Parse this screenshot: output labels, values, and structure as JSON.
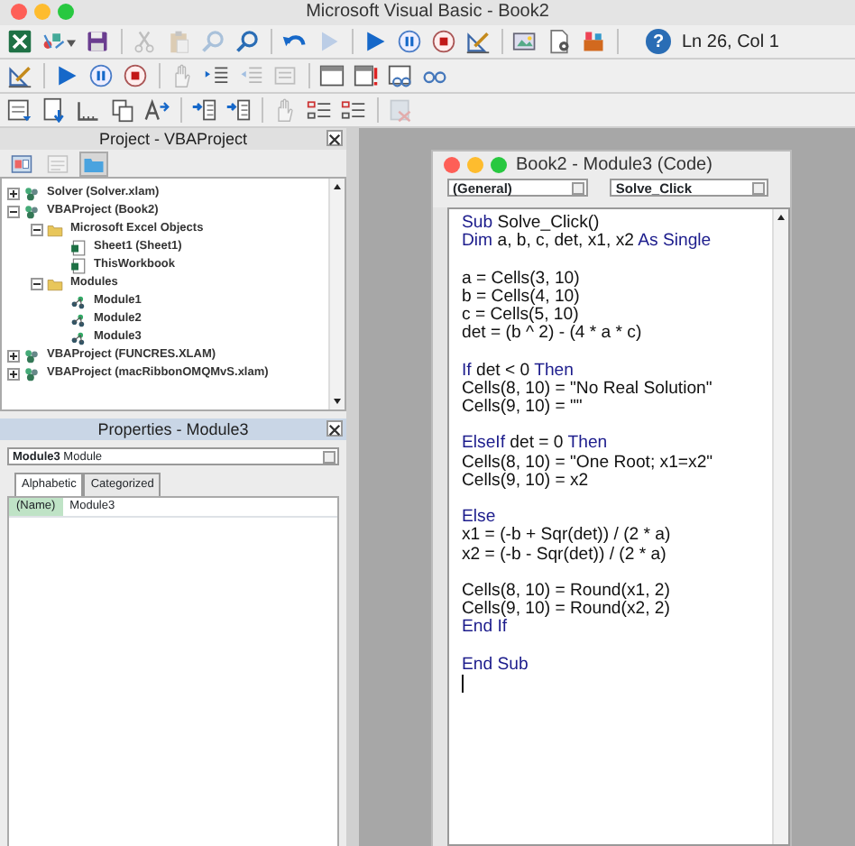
{
  "window": {
    "title": "Microsoft Visual Basic - Book2"
  },
  "toolbars": [
    {
      "items": [
        {
          "kind": "excel",
          "disabled": false
        },
        {
          "kind": "insert",
          "disabled": false
        },
        {
          "kind": "save",
          "disabled": false
        },
        {
          "kind": "separator"
        },
        {
          "kind": "cut",
          "disabled": true
        },
        {
          "kind": "paste",
          "disabled": true
        },
        {
          "kind": "find",
          "disabled": true
        },
        {
          "kind": "find",
          "disabled": false
        },
        {
          "kind": "separator"
        },
        {
          "kind": "undo",
          "disabled": false
        },
        {
          "kind": "redo",
          "disabled": true
        },
        {
          "kind": "separator"
        },
        {
          "kind": "run",
          "disabled": false
        },
        {
          "kind": "pause",
          "disabled": false
        },
        {
          "kind": "stop",
          "disabled": false
        },
        {
          "kind": "design",
          "disabled": false
        },
        {
          "kind": "separator"
        },
        {
          "kind": "explorer",
          "disabled": false
        },
        {
          "kind": "properties",
          "disabled": false
        },
        {
          "kind": "toolbox",
          "disabled": false
        },
        {
          "kind": "separator"
        },
        {
          "kind": "help",
          "disabled": false,
          "glyph": "?"
        }
      ],
      "status": "Ln 26, Col 1"
    },
    {
      "items": [
        {
          "kind": "design",
          "disabled": false
        },
        {
          "kind": "separator"
        },
        {
          "kind": "run",
          "disabled": false
        },
        {
          "kind": "pause",
          "disabled": false
        },
        {
          "kind": "stop",
          "disabled": false
        },
        {
          "kind": "separator"
        },
        {
          "kind": "hand",
          "disabled": true
        },
        {
          "kind": "indent",
          "disabled": false
        },
        {
          "kind": "outdent",
          "disabled": true
        },
        {
          "kind": "comment",
          "disabled": true
        },
        {
          "kind": "separator"
        },
        {
          "kind": "window",
          "disabled": false
        },
        {
          "kind": "window-alert",
          "disabled": false
        },
        {
          "kind": "watch",
          "disabled": false
        },
        {
          "kind": "glasses",
          "disabled": false
        }
      ]
    },
    {
      "items": [
        {
          "kind": "list-doc",
          "disabled": false
        },
        {
          "kind": "down-doc",
          "disabled": false
        },
        {
          "kind": "ruler",
          "disabled": false
        },
        {
          "kind": "copy",
          "disabled": false
        },
        {
          "kind": "replace",
          "disabled": false
        },
        {
          "kind": "separator"
        },
        {
          "kind": "bookmark",
          "disabled": false
        },
        {
          "kind": "bookmark",
          "disabled": false
        },
        {
          "kind": "separator"
        },
        {
          "kind": "hand",
          "disabled": true
        },
        {
          "kind": "list",
          "disabled": false
        },
        {
          "kind": "list",
          "disabled": false
        },
        {
          "kind": "separator"
        },
        {
          "kind": "clear",
          "disabled": true
        }
      ]
    }
  ],
  "project_panel": {
    "title": "Project - VBAProject",
    "view_buttons": [
      {
        "kind": "object",
        "selected": false,
        "disabled": false
      },
      {
        "kind": "code",
        "selected": false,
        "disabled": true
      },
      {
        "kind": "folders",
        "selected": true,
        "disabled": false
      }
    ],
    "tree": [
      {
        "label": "Solver (Solver.xlam)",
        "kind": "project",
        "expanded": false
      },
      {
        "label": "VBAProject (Book2)",
        "kind": "project",
        "expanded": true,
        "children": [
          {
            "label": "Microsoft Excel Objects",
            "kind": "folder",
            "expanded": true,
            "children": [
              {
                "label": "Sheet1 (Sheet1)",
                "kind": "sheet"
              },
              {
                "label": "ThisWorkbook",
                "kind": "sheet"
              }
            ]
          },
          {
            "label": "Modules",
            "kind": "folder",
            "expanded": true,
            "children": [
              {
                "label": "Module1",
                "kind": "module"
              },
              {
                "label": "Module2",
                "kind": "module"
              },
              {
                "label": "Module3",
                "kind": "module"
              }
            ]
          }
        ]
      },
      {
        "label": "VBAProject (FUNCRES.XLAM)",
        "kind": "project",
        "expanded": false
      },
      {
        "label": "VBAProject (macRibbonOMQMvS.xlam)",
        "kind": "project",
        "expanded": false
      }
    ]
  },
  "properties_panel": {
    "title": "Properties - Module3",
    "object": {
      "name": "Module3",
      "type": "Module"
    },
    "tabs": [
      {
        "label": "Alphabetic",
        "selected": true
      },
      {
        "label": "Categorized",
        "selected": false
      }
    ],
    "rows": [
      {
        "name": "(Name)",
        "value": "Module3",
        "selected": true
      }
    ]
  },
  "code_window": {
    "title": "Book2 - Module3 (Code)",
    "object_dropdown": "(General)",
    "procedure_dropdown": "Solve_Click",
    "lines": [
      {
        "kind": "code",
        "tokens": [
          {
            "kind": "keyword",
            "text": "Sub"
          },
          {
            "kind": "plain",
            "text": " Solve_Click()"
          }
        ]
      },
      {
        "kind": "code",
        "tokens": [
          {
            "kind": "keyword",
            "text": "Dim"
          },
          {
            "kind": "plain",
            "text": " a, b, c, det, x1, x2 "
          },
          {
            "kind": "keyword",
            "text": "As Single"
          }
        ]
      },
      {
        "kind": "blank"
      },
      {
        "kind": "code",
        "tokens": [
          {
            "kind": "plain",
            "text": "a = Cells(3, 10)"
          }
        ]
      },
      {
        "kind": "code",
        "tokens": [
          {
            "kind": "plain",
            "text": "b = Cells(4, 10)"
          }
        ]
      },
      {
        "kind": "code",
        "tokens": [
          {
            "kind": "plain",
            "text": "c = Cells(5, 10)"
          }
        ]
      },
      {
        "kind": "code",
        "tokens": [
          {
            "kind": "plain",
            "text": "det = (b ^ 2) - (4 * a * c)"
          }
        ]
      },
      {
        "kind": "blank"
      },
      {
        "kind": "code",
        "tokens": [
          {
            "kind": "keyword",
            "text": "If"
          },
          {
            "kind": "plain",
            "text": " det < 0 "
          },
          {
            "kind": "keyword",
            "text": "Then"
          }
        ]
      },
      {
        "kind": "code",
        "tokens": [
          {
            "kind": "plain",
            "text": "Cells(8, 10) = \"No Real Solution\""
          }
        ]
      },
      {
        "kind": "code",
        "tokens": [
          {
            "kind": "plain",
            "text": "Cells(9, 10) = \"\""
          }
        ]
      },
      {
        "kind": "blank"
      },
      {
        "kind": "code",
        "tokens": [
          {
            "kind": "keyword",
            "text": "ElseIf"
          },
          {
            "kind": "plain",
            "text": " det = 0 "
          },
          {
            "kind": "keyword",
            "text": "Then"
          }
        ]
      },
      {
        "kind": "code",
        "tokens": [
          {
            "kind": "plain",
            "text": "Cells(8, 10) = \"One Root; x1=x2\""
          }
        ]
      },
      {
        "kind": "code",
        "tokens": [
          {
            "kind": "plain",
            "text": "Cells(9, 10) = x2"
          }
        ]
      },
      {
        "kind": "blank"
      },
      {
        "kind": "code",
        "tokens": [
          {
            "kind": "keyword",
            "text": "Else"
          }
        ]
      },
      {
        "kind": "code",
        "tokens": [
          {
            "kind": "plain",
            "text": "x1 = (-b + Sqr(det)) / (2 * a)"
          }
        ]
      },
      {
        "kind": "code",
        "tokens": [
          {
            "kind": "plain",
            "text": "x2 = (-b - Sqr(det)) / (2 * a)"
          }
        ]
      },
      {
        "kind": "blank"
      },
      {
        "kind": "code",
        "tokens": [
          {
            "kind": "plain",
            "text": "Cells(8, 10) = Round(x1, 2)"
          }
        ]
      },
      {
        "kind": "code",
        "tokens": [
          {
            "kind": "plain",
            "text": "Cells(9, 10) = Round(x2, 2)"
          }
        ]
      },
      {
        "kind": "code",
        "tokens": [
          {
            "kind": "keyword",
            "text": "End If"
          }
        ]
      },
      {
        "kind": "blank"
      },
      {
        "kind": "code",
        "tokens": [
          {
            "kind": "keyword",
            "text": "End Sub"
          }
        ]
      },
      {
        "kind": "cursor"
      }
    ]
  }
}
